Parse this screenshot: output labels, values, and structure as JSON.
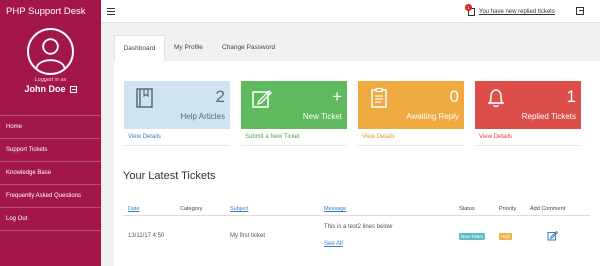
{
  "sidebar": {
    "brand": "PHP Support Desk",
    "logged_in_label": "Logged in as",
    "user_name": "John Doe",
    "items": [
      {
        "label": "Home"
      },
      {
        "label": "Support Tickets"
      },
      {
        "label": "Knowledge Base"
      },
      {
        "label": "Frequently Asked Questions"
      },
      {
        "label": "Log Out"
      }
    ]
  },
  "topbar": {
    "notification_count": "1",
    "notification_text": "You have new replied tickets"
  },
  "tabs": [
    {
      "label": "Dashboard",
      "active": true
    },
    {
      "label": "My Profile",
      "active": false
    },
    {
      "label": "Change Password",
      "active": false
    }
  ],
  "cards": [
    {
      "count": "2",
      "label": "Help Articles",
      "link": "View Details",
      "color": "#cfe3f0",
      "icon": "book-icon"
    },
    {
      "count": "+",
      "label": "New Ticket",
      "link": "Submit a New Ticket",
      "color": "#5fb95f",
      "icon": "edit-icon"
    },
    {
      "count": "0",
      "label": "Awaiting Reply",
      "link": "View Details",
      "color": "#efaa3f",
      "icon": "clipboard-icon"
    },
    {
      "count": "1",
      "label": "Replied Tickets",
      "link": "View Details",
      "color": "#dc4e4a",
      "icon": "bell-icon"
    }
  ],
  "tickets": {
    "title": "Your Latest Tickets",
    "columns": {
      "date": "Date",
      "category": "Category",
      "subject": "Subject",
      "message": "Message",
      "status": "Status",
      "priority": "Priority",
      "add_comment": "Add Comment"
    },
    "rows": [
      {
        "date": "13/11/17 4:50",
        "category": "",
        "subject": "My first ticket",
        "message": "This is a test2 lines below",
        "see_all": "See All",
        "status": "New Ticket",
        "priority": "High"
      }
    ]
  },
  "colors": {
    "sidebar": "#a3164b",
    "link": "#3b7cc7"
  }
}
